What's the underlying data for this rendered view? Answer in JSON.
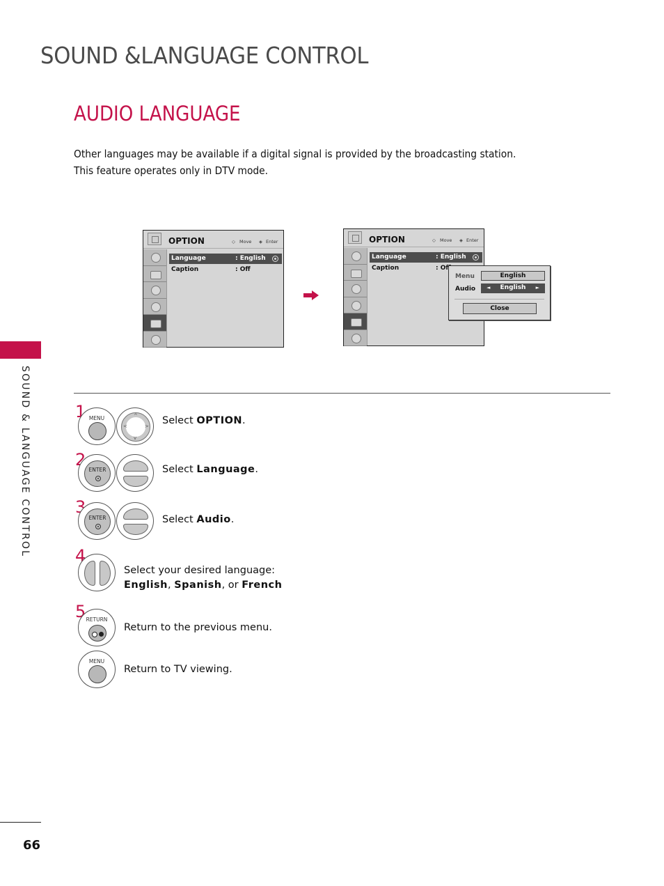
{
  "section_title": "SOUND &LANGUAGE CONTROL",
  "page_title": "AUDIO LANGUAGE",
  "intro": [
    "Other languages may be available if a digital signal is provided by the broadcasting station.",
    "This feature operates only in DTV mode."
  ],
  "side_label": "SOUND & LANGUAGE CONTROL",
  "page_number": "66",
  "accent_color": "#c4124a",
  "screens": [
    {
      "title": "OPTION",
      "hint_move": "Move",
      "hint_enter": "Enter",
      "rows": [
        {
          "label": "Language",
          "value": ": English",
          "selected": true
        },
        {
          "label": "Caption",
          "value": ": Off",
          "selected": false
        }
      ]
    },
    {
      "title": "OPTION",
      "hint_move": "Move",
      "hint_enter": "Enter",
      "rows": [
        {
          "label": "Language",
          "value": ": English",
          "selected": true
        },
        {
          "label": "Caption",
          "value": ": Off",
          "selected": false
        }
      ],
      "popup": {
        "menu_label": "Menu",
        "menu_value": "English",
        "audio_label": "Audio",
        "audio_value": "English",
        "left_arrow": "◄",
        "right_arrow": "►",
        "close_label": "Close"
      }
    }
  ],
  "steps": [
    {
      "num": "1",
      "prefix": "Select ",
      "bold": "OPTION",
      "suffix": ".",
      "button": "MENU"
    },
    {
      "num": "2",
      "prefix": "Select ",
      "bold": "Language",
      "suffix": ".",
      "button": "ENTER"
    },
    {
      "num": "3",
      "prefix": "Select ",
      "bold": "Audio",
      "suffix": ".",
      "button": "ENTER"
    },
    {
      "num": "4",
      "line1": "Select  your  desired  language:",
      "opt1": "English",
      "sep1": ", ",
      "opt2": "Spanish",
      "sep2": ", or ",
      "opt3": "French"
    },
    {
      "num": "5",
      "text": "Return to the previous menu.",
      "button": "RETURN"
    },
    {
      "text": "Return to TV viewing.",
      "button": "MENU"
    }
  ]
}
